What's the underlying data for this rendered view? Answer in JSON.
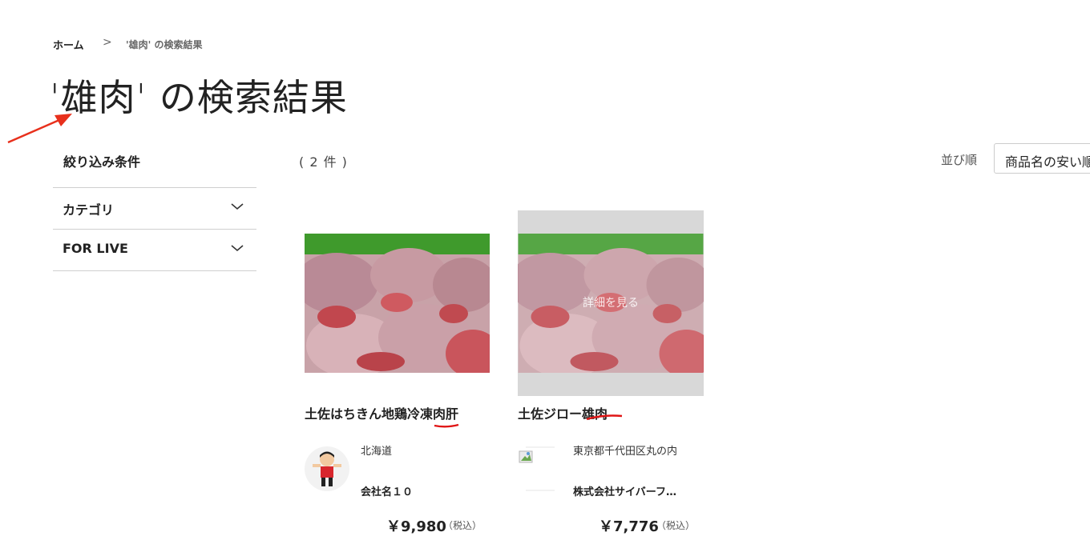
{
  "breadcrumb": {
    "home": "ホーム",
    "separator": ">",
    "current": "'雄肉' の検索結果"
  },
  "page_title": "'雄肉' の検索結果",
  "sidebar": {
    "title": "絞り込み条件",
    "filters": [
      {
        "label": "カテゴリ"
      },
      {
        "label": "FOR LIVE"
      }
    ]
  },
  "results": {
    "count": "( 2 件 )",
    "sort_label": "並び順",
    "sort_value": "商品名の安い順"
  },
  "products": [
    {
      "name": "土佐はちきん地鶏冷凍肉肝",
      "prefecture": "北海道",
      "company": "会社名１０",
      "price": "￥9,980",
      "tax": "（税込）"
    },
    {
      "name": "土佐ジロー雄肉",
      "prefecture": "東京都千代田区丸の内",
      "company": "株式会社サイバーフ…",
      "price": "￥7,776",
      "tax": "（税込）",
      "overlay": "詳細を見る"
    }
  ],
  "colors": {
    "annotation": "#e8301c",
    "divider": "#cfcfcf"
  }
}
